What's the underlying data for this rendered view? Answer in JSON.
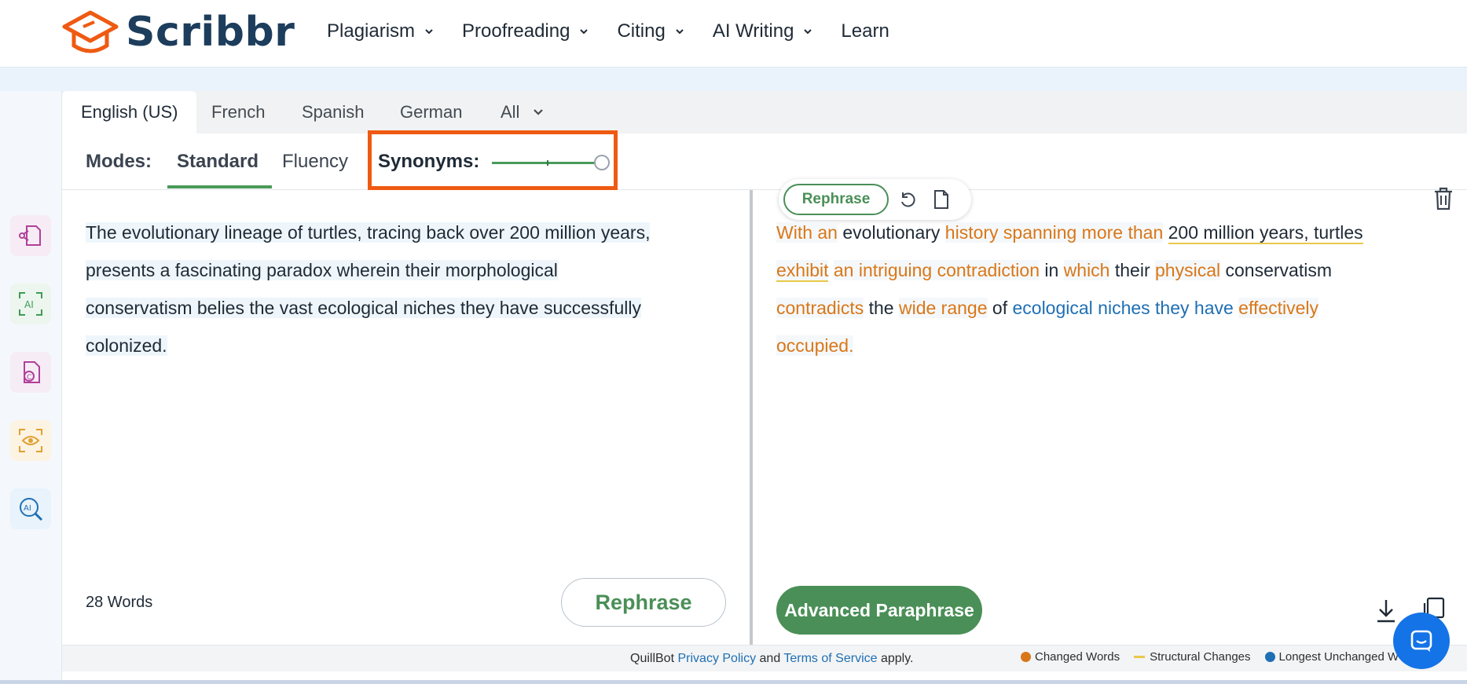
{
  "header": {
    "brand": "Scribbr",
    "nav": [
      {
        "label": "Plagiarism",
        "has_dropdown": true
      },
      {
        "label": "Proofreading",
        "has_dropdown": true
      },
      {
        "label": "Citing",
        "has_dropdown": true
      },
      {
        "label": "AI Writing",
        "has_dropdown": true
      },
      {
        "label": "Learn",
        "has_dropdown": false
      }
    ]
  },
  "sidebar": {
    "icons": [
      {
        "name": "paraphraser-icon",
        "color": "#f7ecf6"
      },
      {
        "name": "ai-detector-icon",
        "color": "#ecf6ee"
      },
      {
        "name": "plagiarism-checker-icon",
        "color": "#f6ecf6"
      },
      {
        "name": "proofreader-icon",
        "color": "#fdf3e3"
      },
      {
        "name": "ai-search-icon",
        "color": "#e8f3fb"
      }
    ]
  },
  "languages": {
    "tabs": [
      "English (US)",
      "French",
      "Spanish",
      "German"
    ],
    "all_label": "All",
    "active": "English (US)"
  },
  "modes": {
    "label": "Modes:",
    "items": [
      "Standard",
      "Fluency"
    ],
    "active": "Standard",
    "synonyms_label": "Synonyms:",
    "synonyms_level": 1.0
  },
  "input": {
    "text": "The evolutionary lineage of turtles, tracing back over 200 million years, presents a fascinating paradox wherein their morphological conservatism belies the vast ecological niches they have successfully colonized.",
    "lines": [
      "The evolutionary lineage of turtles, tracing back over 200 million years,",
      "presents a fascinating paradox wherein their morphological",
      "conservatism belies the vast ecological niches they have successfully",
      "colonized."
    ],
    "word_count": "28 Words",
    "rephrase_label": "Rephrase"
  },
  "output": {
    "float_rephrase_label": "Rephrase",
    "segments": {
      "s1": "With an",
      "s2": "evolutionary",
      "s3": "history spanning more than",
      "s4": "200 million years, turtles",
      "s5": "exhibit",
      "s6": "an intriguing contradiction",
      "s7": "in",
      "s8": "which",
      "s9": "their",
      "s10": "physical",
      "s11": "conservatism",
      "s12": "contradicts",
      "s13": "the",
      "s14": "wide range",
      "s15": "of",
      "s16": "ecological niches they have",
      "s17": "effectively",
      "s18": "occupied."
    },
    "advanced_label": "Advanced Paraphrase"
  },
  "footer": {
    "prefix": "QuillBot",
    "privacy": "Privacy Policy",
    "and": "and",
    "terms": "Terms of Service",
    "suffix": "apply.",
    "legend": [
      {
        "label": "Changed Words",
        "color": "#d97718"
      },
      {
        "label": "Structural Changes",
        "color": "#e9c94a"
      },
      {
        "label": "Longest Unchanged W",
        "color": "#1e6fb4"
      }
    ]
  },
  "colors": {
    "accent_green": "#4a8f57",
    "highlight_orange": "#ef5a12",
    "brand_navy": "#1d3d5c"
  }
}
